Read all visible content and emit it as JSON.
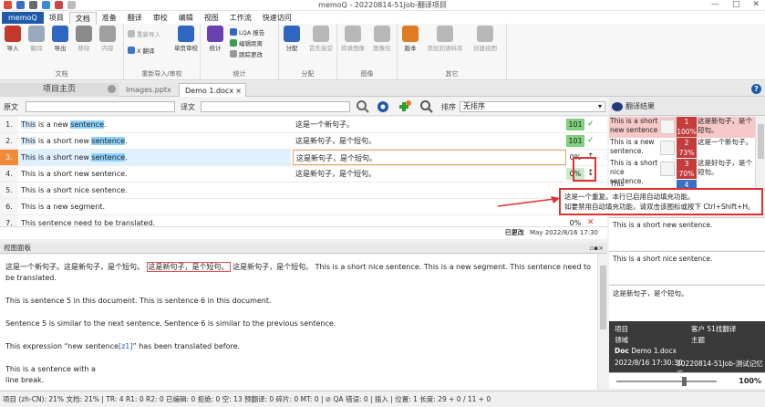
{
  "window": {
    "title": "memoQ - 20220814-51Job-翻译项目",
    "minimize": "—",
    "maximize": "□",
    "close": "✕"
  },
  "menu": {
    "app": "memoQ",
    "items": [
      "项目",
      "文档",
      "准备",
      "翻译",
      "审校",
      "编辑",
      "视图",
      "工作流",
      "快速访问"
    ],
    "active_index": 1
  },
  "ribbon": {
    "groups": [
      {
        "label": "文档",
        "buttons": [
          "导入",
          "翻译",
          "导出",
          "移除",
          "内容"
        ]
      },
      {
        "label": "重新导入/审校",
        "buttons": [
          "重新导入",
          "X 翻译",
          "单页审校"
        ]
      },
      {
        "label": "统计",
        "buttons": [
          "统计",
          "LQA 报告",
          "编辑距离",
          "跟踪更改"
        ]
      },
      {
        "label": "分配",
        "buttons": [
          "分配",
          "首先接受"
        ]
      },
      {
        "label": "图像",
        "buttons": [
          "转录图像",
          "图像包"
        ]
      },
      {
        "label": "其它",
        "buttons": [
          "版本",
          "添加到语料库",
          "创建视图"
        ]
      }
    ]
  },
  "doc_tabs": {
    "home": "项目主页",
    "tabs": [
      {
        "label": "Images.pptx",
        "active": false
      },
      {
        "label": "Demo 1.docx",
        "active": true
      }
    ]
  },
  "filter": {
    "source_label": "原文",
    "target_label": "译文",
    "sort_label": "排序",
    "sort_value": "无排序"
  },
  "segments": [
    {
      "num": "1.",
      "src_pre": "",
      "src_this": "This",
      "src_mid": " is a new ",
      "src_term": "sentence",
      "src_post": ".",
      "tgt": "这是一个新句子。",
      "match": "101",
      "status": "✓"
    },
    {
      "num": "2.",
      "src_pre": "",
      "src_this": "This",
      "src_mid": " is a short new ",
      "src_term": "sentence",
      "src_post": ".",
      "tgt": "这是新句子，是个短句。",
      "match": "101",
      "status": "✓"
    },
    {
      "num": "3.",
      "src_pre": "",
      "src_this": "This",
      "src_mid": " is a short new ",
      "src_term": "sentence",
      "src_post": ".",
      "tgt": "这是新句子，是个短句。",
      "match": "0%",
      "status": "↕"
    },
    {
      "num": "4.",
      "src_pre": "This is a short new sentence.",
      "src_this": "",
      "src_mid": "",
      "src_term": "",
      "src_post": "",
      "tgt": "这是新句子，是个短句。",
      "match": "0%",
      "status": "↕"
    },
    {
      "num": "5.",
      "src_pre": "This is a short nice sentence.",
      "src_this": "",
      "src_mid": "",
      "src_term": "",
      "src_post": "",
      "tgt": "",
      "match": "",
      "status": ""
    },
    {
      "num": "6.",
      "src_pre": "This is a new segment.",
      "src_this": "",
      "src_mid": "",
      "src_term": "",
      "src_post": "",
      "tgt": "",
      "match": "",
      "status": ""
    },
    {
      "num": "7.",
      "src_pre": "This sentence need to be translated.",
      "src_this": "",
      "src_mid": "",
      "src_term": "",
      "src_post": "",
      "tgt": "",
      "match": "0%",
      "status": "✕"
    }
  ],
  "grid_status": {
    "label": "已更改",
    "date": "May 2022/8/16 17:30"
  },
  "view_pane": {
    "header": "视图面板",
    "para1_zh_a": "这是一个新句子。这是新句子，是个短句。",
    "para1_zh_box": "这是新句子，是个短句。",
    "para1_zh_b": "这是新句子，是个短句。",
    "para1_en": " This is a short nice sentence. This is a new segment. This sentence need to be translated.",
    "para2": "This is sentence 5 in this document. This is sentence 6 in this document.",
    "para3": "Sentence 5 is similar to the next sentence. Sentence 6 is similar to the previous sentence.",
    "para4_a": "This expression “new sentence",
    "para4_tag": "[z1]",
    "para4_b": "” has been translated before.",
    "para5_a": "This is a sentence with a",
    "para5_b": "line break."
  },
  "right_panel": {
    "header": "翻译结果",
    "tm": [
      {
        "src": "This is a short new sentence",
        "num": "1",
        "pct": "100%",
        "tgt": "这是新句子，是个短句。"
      },
      {
        "src": "This is a new sentence.",
        "num": "2",
        "pct": "73%",
        "tgt": "这是一个新句子。"
      },
      {
        "src": "This is a short nice sentence.",
        "num": "3",
        "pct": "70%",
        "tgt": "这是好句子，是个短句。"
      },
      {
        "src": "This",
        "num": "4",
        "pct": "",
        "tgt": ""
      }
    ],
    "box1": "This is a short new sentence.",
    "box2": "This is a short nice sentence.",
    "box3": "这是新句子，是个短句。"
  },
  "info": {
    "project_label": "项目",
    "client_label": "客户",
    "client_value": "51找翻译",
    "domain_label": "领域",
    "subject_label": "主题",
    "doc_label": "Doc",
    "doc_value": "Demo 1.docx",
    "date": "2022/8/16 17:30:30",
    "project_value": "20220814-51Job-测试记忆库",
    "zoom": "100%"
  },
  "tooltip": {
    "line1": "这是一个重复。本行已启用自动填充功能。",
    "line2": "如要禁用自动填充功能，请双击该图标或按下 Ctrl+Shift+H。"
  },
  "statusbar": {
    "text": "项目 (zh-CN): 21%  文档: 21% | TR: 4  R1: 0  R2: 0  已编辑: 0  拒绝: 0  空: 13  预翻译: 0  碎片: 0  MT: 0 | ⊘ QA 错误: 0 | 插入 | 位置: 1  长度: 29 + 0 / 11 + 0"
  },
  "colors": {
    "brand": "#1e5aa8",
    "current_row": "#f08c38",
    "match_101": "#7fd07f",
    "tm_percent": "#c43c3c",
    "highlight_box": "#e03030"
  }
}
